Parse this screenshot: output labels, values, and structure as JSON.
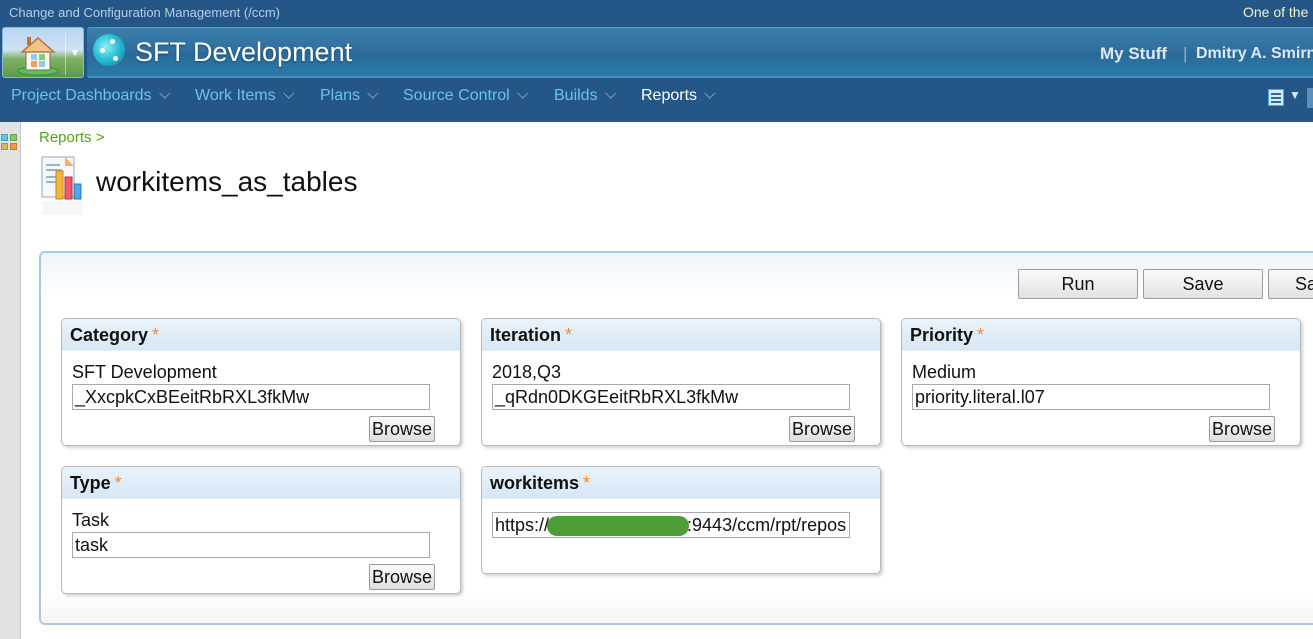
{
  "top_strip": {
    "app_title": "Change and Configuration Management (/ccm)",
    "tagline": "One of the"
  },
  "banner": {
    "home_icon": "home-icon",
    "project_name": "SFT Development",
    "my_stuff": "My Stuff",
    "separator": "|",
    "user_name": "Dmitry A. Smirn"
  },
  "nav": {
    "items": [
      {
        "label": "Project Dashboards",
        "active": false
      },
      {
        "label": "Work Items",
        "active": false
      },
      {
        "label": "Plans",
        "active": false
      },
      {
        "label": "Source Control",
        "active": false
      },
      {
        "label": "Builds",
        "active": false
      },
      {
        "label": "Reports",
        "active": true
      }
    ],
    "view_icon": "view-list-icon",
    "view_arrow": "▼"
  },
  "breadcrumb": "Reports >",
  "page": {
    "title": "workitems_as_tables",
    "icon": "report-chart-icon"
  },
  "toolbar": {
    "run_label": "Run",
    "save_label": "Save",
    "save_as_label": "Sa"
  },
  "parameters": [
    {
      "name": "Category",
      "required": "*",
      "display_value": "SFT Development",
      "id_value": "_XxcpkCxBEeitRbRXL3fkMw",
      "browse_label": "Browse"
    },
    {
      "name": "Iteration",
      "required": "*",
      "display_value": "2018,Q3",
      "id_value": "_qRdn0DKGEeitRbRXL3fkMw",
      "browse_label": "Browse"
    },
    {
      "name": "Priority",
      "required": "*",
      "display_value": "Medium",
      "id_value": "priority.literal.l07",
      "browse_label": "Browse"
    },
    {
      "name": "Type",
      "required": "*",
      "display_value": "Task",
      "id_value": "task",
      "browse_label": "Browse"
    },
    {
      "name": "workitems",
      "required": "*",
      "url_prefix": "https://",
      "url_suffix": ":9443/ccm/rpt/repos"
    }
  ],
  "colors": {
    "header_bg": "#245688",
    "nav_link": "#6cc3e8",
    "breadcrumb": "#54a01c",
    "required_star": "#f08a3c",
    "panel_border": "#a7cbe6"
  }
}
